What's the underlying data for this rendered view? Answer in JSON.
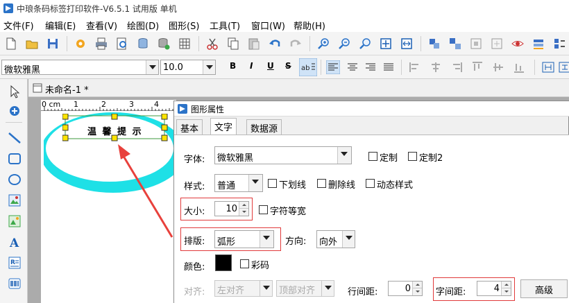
{
  "window": {
    "title": "中琅条码标签打印软件-V6.5.1 试用版 单机"
  },
  "menu": [
    "文件(F)",
    "编辑(E)",
    "查看(V)",
    "绘图(D)",
    "图形(S)",
    "工具(T)",
    "窗口(W)",
    "帮助(H)"
  ],
  "font_toolbar": {
    "font_name": "微软雅黑",
    "font_size": "10.0",
    "bold": "B",
    "italic": "I",
    "underline": "U",
    "strike": "S"
  },
  "document": {
    "tab_title": "未命名-1 *",
    "ruler_labels": [
      "0 cm",
      "1",
      "2",
      "3",
      "4"
    ],
    "label_text": "温 馨 提 示"
  },
  "dialog": {
    "title": "图形属性",
    "tabs": [
      "基本",
      "文字",
      "数据源"
    ],
    "active_tab": "文字",
    "font_label": "字体:",
    "font_value": "微软雅黑",
    "custom_label": "定制",
    "custom2_label": "定制2",
    "style_label": "样式:",
    "style_value": "普通",
    "underline_label": "下划线",
    "strikethrough_label": "删除线",
    "dynamic_style_label": "动态样式",
    "size_label": "大小:",
    "size_value": "10",
    "equal_width_label": "字符等宽",
    "layout_label": "排版:",
    "layout_value": "弧形",
    "direction_label": "方向:",
    "direction_value": "向外",
    "color_label": "颜色:",
    "color_value": "#000000",
    "colorful_label": "彩码",
    "align_label": "对齐:",
    "h_align_value": "左对齐",
    "v_align_value": "顶部对齐",
    "line_spacing_label": "行间距:",
    "line_spacing_value": "0",
    "char_spacing_label": "字间距:",
    "char_spacing_value": "4",
    "advanced_label": "高级"
  },
  "colors": {
    "highlight_red": "#e0393a",
    "ellipse_cyan": "#1ee0e6",
    "arrow_red": "#e8413c"
  }
}
